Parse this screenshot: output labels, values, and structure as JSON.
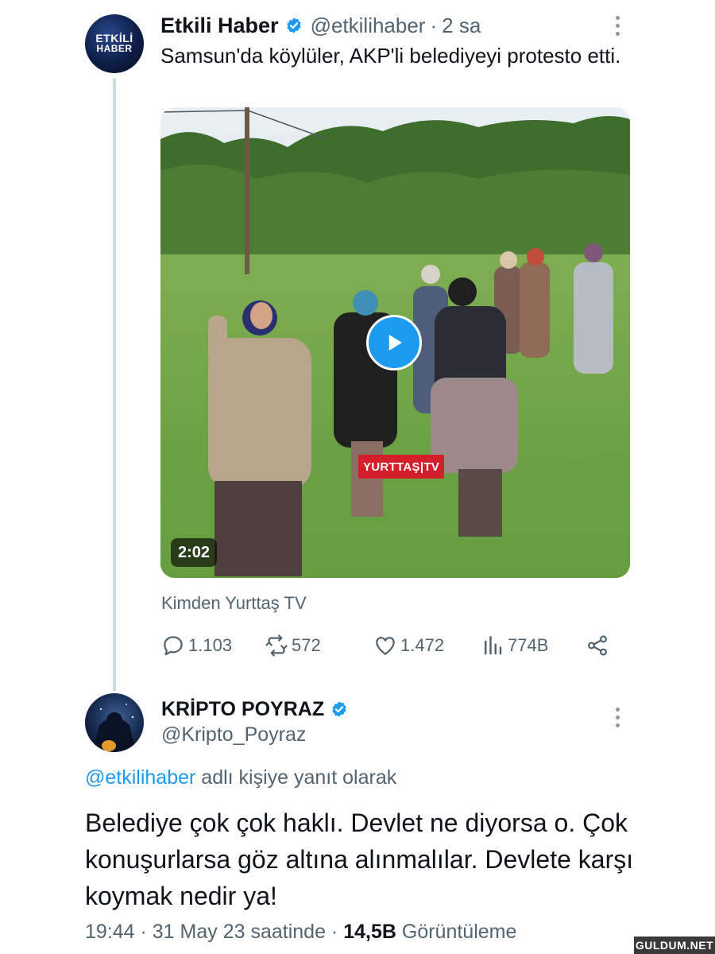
{
  "tweet": {
    "author_name": "Etkili Haber",
    "avatar_line1": "ETKİLİ",
    "avatar_line2": "HABER",
    "handle": "@etkilihaber",
    "separator": "·",
    "time": "2 sa",
    "text": "Samsun'da köylüler, AKP'li belediyeyi protesto etti.",
    "video": {
      "duration": "2:02",
      "logo_text": "YURTTAŞ|TV"
    },
    "source": "Kimden Yurttaş TV",
    "stats": {
      "replies": "1.103",
      "retweets": "572",
      "likes": "1.472",
      "views": "774B"
    }
  },
  "reply": {
    "author_name": "KRİPTO POYRAZ",
    "handle": "@Kripto_Poyraz",
    "reply_to_link": "@etkilihaber",
    "reply_to_suffix": " adlı kişiye yanıt olarak",
    "text": "Belediye çok çok haklı. Devlet ne diyorsa o. Çok konuşurlarsa göz altına alınmalılar. Devlete karşı koymak nedir ya!",
    "time": "19:44",
    "separator1": " · ",
    "date": "31 May 23 saatinde",
    "separator2": " · ",
    "views_count": "14,5B",
    "views_label": " Görüntüleme"
  },
  "watermark": "GULDUM.NET",
  "colors": {
    "accent": "#1d9bf0",
    "text_primary": "#0f1419",
    "text_secondary": "#536471",
    "thread_line": "#cfd9de"
  }
}
